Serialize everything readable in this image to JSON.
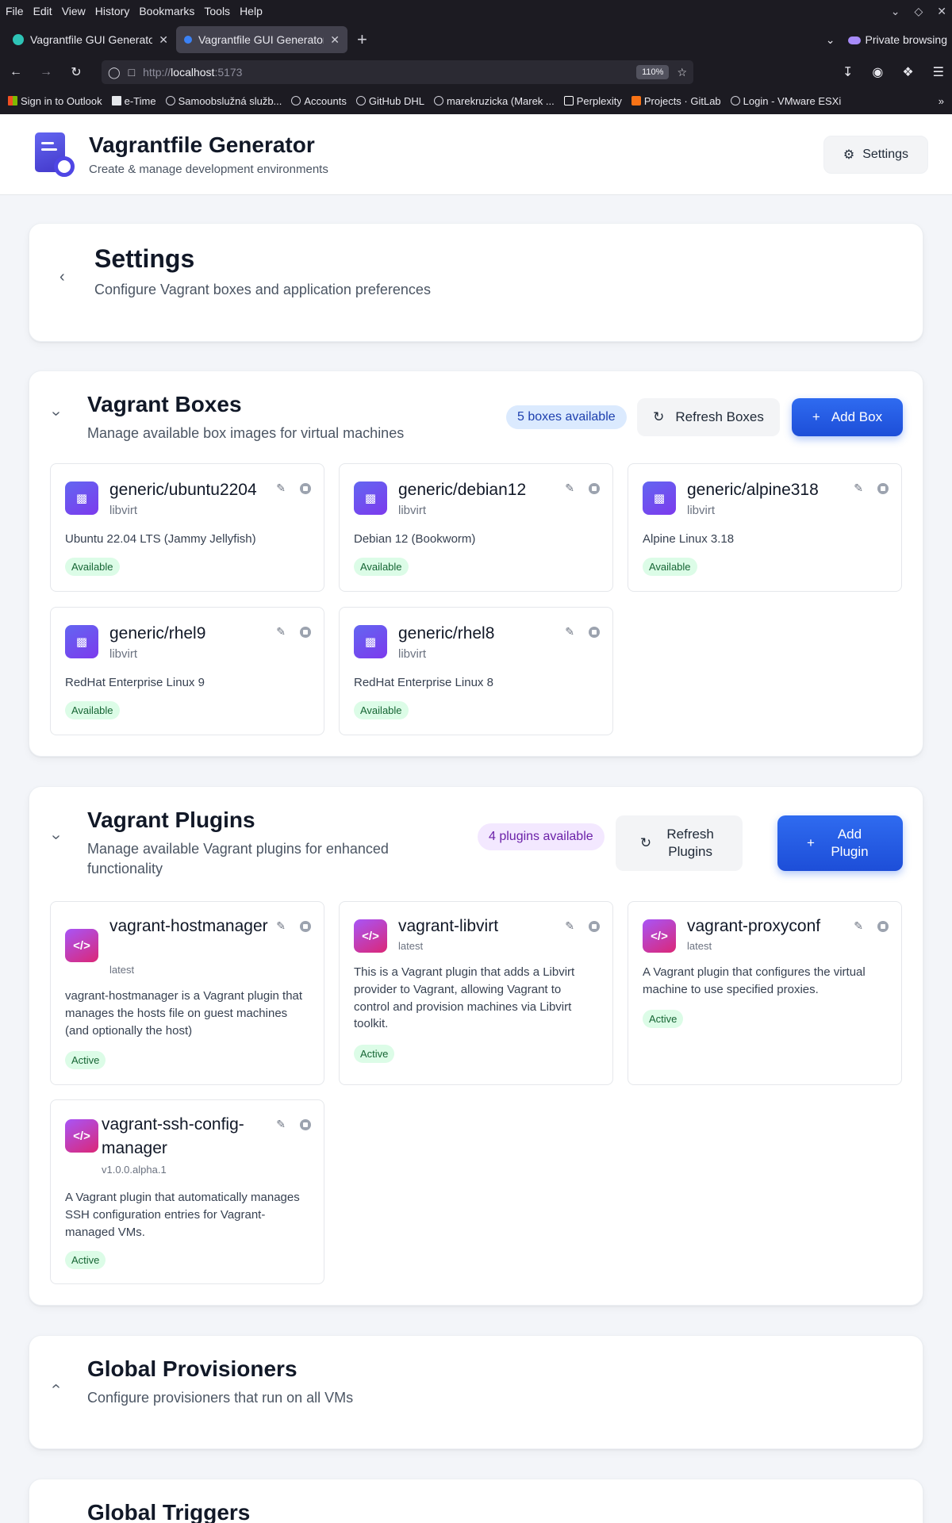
{
  "browser": {
    "menu": [
      "File",
      "Edit",
      "View",
      "History",
      "Bookmarks",
      "Tools",
      "Help"
    ],
    "tabs": [
      {
        "title": "Vagrantfile GUI Generator",
        "active": false
      },
      {
        "title": "Vagrantfile GUI Generator",
        "active": true
      }
    ],
    "private_label": "Private browsing",
    "url_prefix": "http://",
    "url_host": "localhost",
    "url_port": ":5173",
    "zoom": "110%",
    "bookmarks": [
      {
        "label": "Sign in to Outlook",
        "icon": "microsoft-icon"
      },
      {
        "label": "e-Time",
        "icon": "page-icon"
      },
      {
        "label": "Samoobslužná služb...",
        "icon": "globe-icon"
      },
      {
        "label": "Accounts",
        "icon": "globe-icon"
      },
      {
        "label": "GitHub DHL",
        "icon": "github-icon"
      },
      {
        "label": "marekruzicka (Marek ...",
        "icon": "github-icon"
      },
      {
        "label": "Perplexity",
        "icon": "perplexity-icon"
      },
      {
        "label": "Projects · GitLab",
        "icon": "gitlab-icon"
      },
      {
        "label": "Login - VMware ESXi",
        "icon": "globe-icon"
      }
    ]
  },
  "app": {
    "title": "Vagrantfile Generator",
    "subtitle": "Create & manage development environments",
    "settings_button": "Settings"
  },
  "settings_header": {
    "title": "Settings",
    "subtitle": "Configure Vagrant boxes and application preferences"
  },
  "boxes": {
    "title": "Vagrant Boxes",
    "subtitle": "Manage available box images for virtual machines",
    "count": "5 boxes available",
    "refresh": "Refresh Boxes",
    "add": "Add Box",
    "items": [
      {
        "name": "generic/ubuntu2204",
        "provider": "libvirt",
        "desc": "Ubuntu 22.04 LTS (Jammy Jellyfish)",
        "status": "Available"
      },
      {
        "name": "generic/debian12",
        "provider": "libvirt",
        "desc": "Debian 12 (Bookworm)",
        "status": "Available"
      },
      {
        "name": "generic/alpine318",
        "provider": "libvirt",
        "desc": "Alpine Linux 3.18",
        "status": "Available"
      },
      {
        "name": "generic/rhel9",
        "provider": "libvirt",
        "desc": "RedHat Enterprise Linux 9",
        "status": "Available"
      },
      {
        "name": "generic/rhel8",
        "provider": "libvirt",
        "desc": "RedHat Enterprise Linux 8",
        "status": "Available"
      }
    ]
  },
  "plugins": {
    "title": "Vagrant Plugins",
    "subtitle": "Manage available Vagrant plugins for enhanced functionality",
    "count": "4 plugins available",
    "refresh": "Refresh Plugins",
    "add": "Add Plugin",
    "items": [
      {
        "name": "vagrant-hostmanager",
        "version": "latest",
        "desc": "vagrant-hostmanager is a Vagrant plugin that manages the hosts file on guest machines (and optionally the host)",
        "status": "Active"
      },
      {
        "name": "vagrant-libvirt",
        "version": "latest",
        "desc": "This is a Vagrant plugin that adds a Libvirt provider to Vagrant, allowing Vagrant to control and provision machines via Libvirt toolkit.",
        "status": "Active"
      },
      {
        "name": "vagrant-proxyconf",
        "version": "latest",
        "desc": "A Vagrant plugin that configures the virtual machine to use specified proxies.",
        "status": "Active"
      },
      {
        "name": "vagrant-ssh-config-manager",
        "version": "v1.0.0.alpha.1",
        "desc": "A Vagrant plugin that automatically manages SSH configuration entries for Vagrant-managed VMs.",
        "status": "Active"
      }
    ]
  },
  "provisioners": {
    "title": "Global Provisioners",
    "subtitle": "Configure provisioners that run on all VMs"
  },
  "triggers": {
    "title": "Global Triggers"
  },
  "colors": {
    "primary": "#2563eb",
    "accent": "#4f46e5",
    "success_bg": "#dcfce7",
    "success_fg": "#166534"
  }
}
